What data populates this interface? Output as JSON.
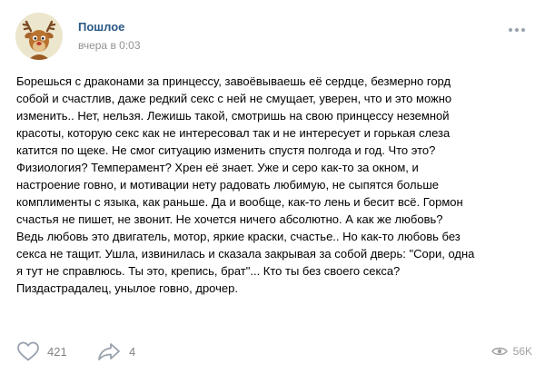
{
  "post": {
    "author": "Пошлое",
    "time": "вчера в 0:03",
    "text": "Борешься с драконами за принцессу, завоёвываешь её сердце, безмерно горд\nсобой и счастлив, даже редкий секс с ней не смущает, уверен, что и это можно\nизменить.. Нет, нельзя. Лежишь такой, смотришь на свою принцессу неземной\nкрасоты, которую секс как не интересовал так и не интересует и горькая слеза\nкатится по щеке. Не смог ситуацию изменить спустя полгода и год. Что это?\nФизиология? Темперамент? Хрен её знает. Уже и серо как-то за окном, и\nнастроение говно, и мотивации нету радовать любимую, не сыпятся больше\nкомплименты с языка, как раньше. Да и вообще, как-то лень и бесит всё. Гормон\nсчастья не пишет, не звонит. Не хочется ничего абсолютно. А как же любовь?\nВедь любовь это двигатель, мотор, яркие краски, счастье.. Но как-то любовь без\nсекса не тащит. Ушла, извинилась и сказала закрывая за собой дверь: \"Сори, одна\nя тут не справлюсь. Ты это, крепись, брат\"... Кто ты без своего секса?\nПиздастрадалец, унылое говно, дрочер."
  },
  "actions": {
    "likes": "421",
    "shares": "4",
    "views": "56K"
  },
  "icons": {
    "avatar": "reindeer-avatar",
    "more": "more-dots-icon",
    "like": "heart-icon",
    "share": "share-arrow-icon",
    "views": "eye-icon"
  },
  "colors": {
    "author": "#2a5885",
    "muted": "#828282",
    "icon": "#99a2ad"
  }
}
